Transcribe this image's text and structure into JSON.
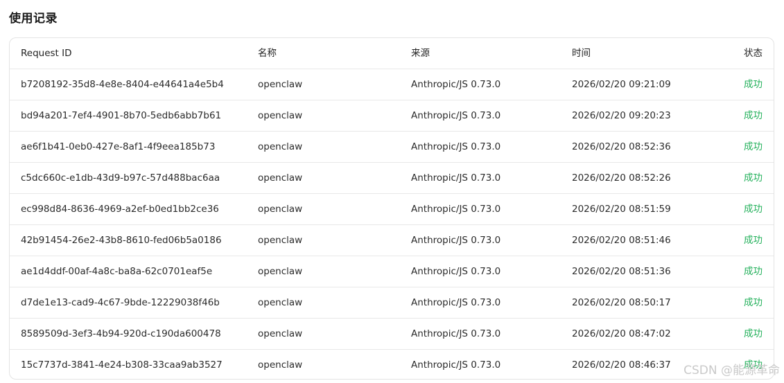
{
  "page": {
    "title": "使用记录"
  },
  "table": {
    "columns": {
      "request_id": "Request ID",
      "name": "名称",
      "source": "来源",
      "time": "时间",
      "status": "状态"
    },
    "rows": [
      {
        "request_id": "b7208192-35d8-4e8e-8404-e44641a4e5b4",
        "name": "openclaw",
        "source": "Anthropic/JS 0.73.0",
        "time": "2026/02/20 09:21:09",
        "status": "成功"
      },
      {
        "request_id": "bd94a201-7ef4-4901-8b70-5edb6abb7b61",
        "name": "openclaw",
        "source": "Anthropic/JS 0.73.0",
        "time": "2026/02/20 09:20:23",
        "status": "成功"
      },
      {
        "request_id": "ae6f1b41-0eb0-427e-8af1-4f9eea185b73",
        "name": "openclaw",
        "source": "Anthropic/JS 0.73.0",
        "time": "2026/02/20 08:52:36",
        "status": "成功"
      },
      {
        "request_id": "c5dc660c-e1db-43d9-b97c-57d488bac6aa",
        "name": "openclaw",
        "source": "Anthropic/JS 0.73.0",
        "time": "2026/02/20 08:52:26",
        "status": "成功"
      },
      {
        "request_id": "ec998d84-8636-4969-a2ef-b0ed1bb2ce36",
        "name": "openclaw",
        "source": "Anthropic/JS 0.73.0",
        "time": "2026/02/20 08:51:59",
        "status": "成功"
      },
      {
        "request_id": "42b91454-26e2-43b8-8610-fed06b5a0186",
        "name": "openclaw",
        "source": "Anthropic/JS 0.73.0",
        "time": "2026/02/20 08:51:46",
        "status": "成功"
      },
      {
        "request_id": "ae1d4ddf-00af-4a8c-ba8a-62c0701eaf5e",
        "name": "openclaw",
        "source": "Anthropic/JS 0.73.0",
        "time": "2026/02/20 08:51:36",
        "status": "成功"
      },
      {
        "request_id": "d7de1e13-cad9-4c67-9bde-12229038f46b",
        "name": "openclaw",
        "source": "Anthropic/JS 0.73.0",
        "time": "2026/02/20 08:50:17",
        "status": "成功"
      },
      {
        "request_id": "8589509d-3ef3-4b94-920d-c190da600478",
        "name": "openclaw",
        "source": "Anthropic/JS 0.73.0",
        "time": "2026/02/20 08:47:02",
        "status": "成功"
      },
      {
        "request_id": "15c7737d-3841-4e24-b308-33caa9ab3527",
        "name": "openclaw",
        "source": "Anthropic/JS 0.73.0",
        "time": "2026/02/20 08:46:37",
        "status": "成功"
      }
    ]
  },
  "watermark": "CSDN @能源革命",
  "colors": {
    "status_success": "#22b05a",
    "border": "#e3e3e3"
  }
}
